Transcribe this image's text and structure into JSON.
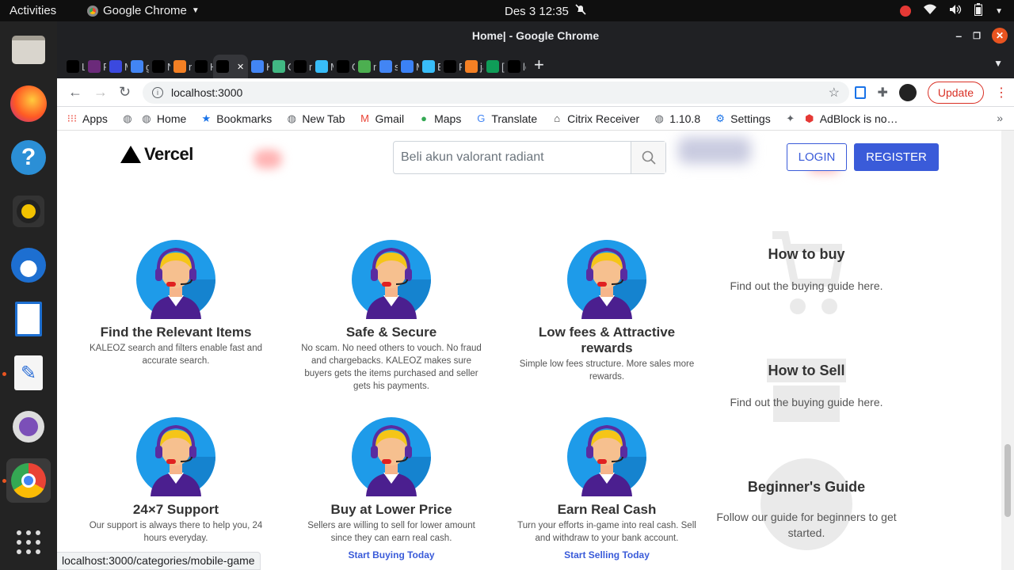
{
  "topbar": {
    "activities": "Activities",
    "app_name": "Google Chrome",
    "clock": "Des 3  12:35"
  },
  "window": {
    "title": "Home| - Google Chrome"
  },
  "tabs": [
    {
      "label": "La",
      "icon": "dev-icon",
      "color": "#000000"
    },
    {
      "label": "Re",
      "icon": "f-icon",
      "color": "#6b2a7a"
    },
    {
      "label": "M",
      "icon": "mask-icon",
      "color": "#3b49df"
    },
    {
      "label": "gc",
      "icon": "google-icon",
      "color": "#4285f4"
    },
    {
      "label": "N",
      "icon": "github-icon",
      "color": "#000000"
    },
    {
      "label": "re",
      "icon": "stackoverflow-icon",
      "color": "#f48024"
    },
    {
      "label": "H",
      "icon": "vercel-icon",
      "color": "#000000"
    },
    {
      "label": "",
      "icon": "vercel-icon",
      "color": "#000000",
      "active": true
    },
    {
      "label": "K",
      "icon": "k-icon",
      "color": "#4285f4"
    },
    {
      "label": "O",
      "icon": "vue-icon",
      "color": "#41b883"
    },
    {
      "label": "m",
      "icon": "github-icon",
      "color": "#000000"
    },
    {
      "label": "M",
      "icon": "tailwind-icon",
      "color": "#38bdf8"
    },
    {
      "label": "G",
      "icon": "github-icon",
      "color": "#000000"
    },
    {
      "label": "ne",
      "icon": "x-icon",
      "color": "#4caf50"
    },
    {
      "label": "sv",
      "icon": "google-icon",
      "color": "#4285f4"
    },
    {
      "label": "M",
      "icon": "m-icon",
      "color": "#3b82f6"
    },
    {
      "label": "B",
      "icon": "tailwind-icon",
      "color": "#38bdf8"
    },
    {
      "label": "Pr",
      "icon": "trello-icon",
      "color": "#000000"
    },
    {
      "label": "ja",
      "icon": "stackoverflow-icon",
      "color": "#f48024"
    },
    {
      "label": "[S",
      "icon": "s-icon",
      "color": "#0f9d58"
    },
    {
      "label": "lo",
      "icon": "vercel-icon",
      "color": "#000000"
    }
  ],
  "toolbar": {
    "url": "localhost:3000",
    "update_label": "Update"
  },
  "bookmarks": [
    {
      "label": "Apps",
      "icon": "apps-grid-icon"
    },
    {
      "label": "",
      "icon": "globe-icon"
    },
    {
      "label": "Home",
      "icon": "globe-icon"
    },
    {
      "label": "Bookmarks",
      "icon": "star-icon"
    },
    {
      "label": "New Tab",
      "icon": "globe-icon"
    },
    {
      "label": "Gmail",
      "icon": "gmail-icon"
    },
    {
      "label": "Maps",
      "icon": "maps-icon"
    },
    {
      "label": "Translate",
      "icon": "translate-icon"
    },
    {
      "label": "Citrix Receiver",
      "icon": "citrix-icon"
    },
    {
      "label": "1.10.8",
      "icon": "globe-icon"
    },
    {
      "label": "Settings",
      "icon": "gear-icon"
    },
    {
      "label": "",
      "icon": "plugin-icon"
    },
    {
      "label": "AdBlock is no…",
      "icon": "adblock-icon"
    }
  ],
  "site": {
    "logo": "Vercel",
    "search_placeholder": "Beli akun valorant radiant",
    "login": "LOGIN",
    "register": "REGISTER"
  },
  "features": [
    {
      "title": "Find the Relevant Items",
      "desc": "KALEOZ search and filters enable fast and accurate search.",
      "link": ""
    },
    {
      "title": "Safe & Secure",
      "desc": "No scam. No need others to vouch. No fraud and chargebacks. KALEOZ makes sure buyers gets the items purchased and seller gets his payments.",
      "link": ""
    },
    {
      "title": "Low fees & Attractive rewards",
      "desc": "Simple low fees structure. More sales more rewards.",
      "link": ""
    },
    {
      "title": "24×7 Support",
      "desc": "Our support is always there to help you, 24 hours everyday.",
      "link": ""
    },
    {
      "title": "Buy at Lower Price",
      "desc": "Sellers are willing to sell for lower amount since they can earn real cash.",
      "link": "Start Buying Today"
    },
    {
      "title": "Earn Real Cash",
      "desc": "Turn your efforts in-game into real cash. Sell and withdraw to your bank account.",
      "link": "Start Selling Today"
    }
  ],
  "guides": [
    {
      "title": "How to buy",
      "desc": "Find out the buying guide here."
    },
    {
      "title": "How to Sell",
      "desc": "Find out the buying guide here."
    },
    {
      "title": "Beginner's Guide",
      "desc": "Follow our guide for beginners to get started."
    }
  ],
  "status_url": "localhost:3000/categories/mobile-game",
  "colors": {
    "primary": "#3a5bd9",
    "chrome_dark": "#202124",
    "update_red": "#d93025"
  }
}
